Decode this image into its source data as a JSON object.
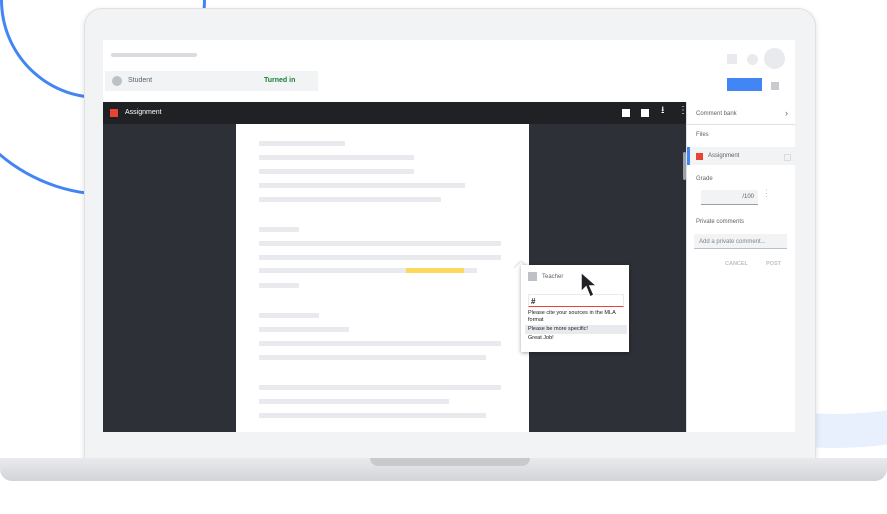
{
  "header": {
    "student_name": "Student",
    "status": "Turned in"
  },
  "viewer": {
    "title": "Assignment"
  },
  "comment_popup": {
    "author": "Teacher",
    "input_value": "#",
    "suggestions": [
      "Please cite your sources in the MLA format",
      "Please be more specific!",
      "Great Job!"
    ]
  },
  "right_panel": {
    "comment_bank_label": "Comment bank",
    "files_label": "Files",
    "file_name": "Assignment",
    "grade_label": "Grade",
    "grade_value": "/100",
    "private_comments_label": "Private comments",
    "private_comment_placeholder": "Add a private comment...",
    "cancel_label": "CANCEL",
    "post_label": "POST"
  },
  "colors": {
    "accent_blue": "#4285f4",
    "assignment_red": "#ea4335",
    "turned_in_green": "#188038",
    "highlight_yellow": "#fbd75b",
    "viewer_bg": "#2d3036"
  }
}
